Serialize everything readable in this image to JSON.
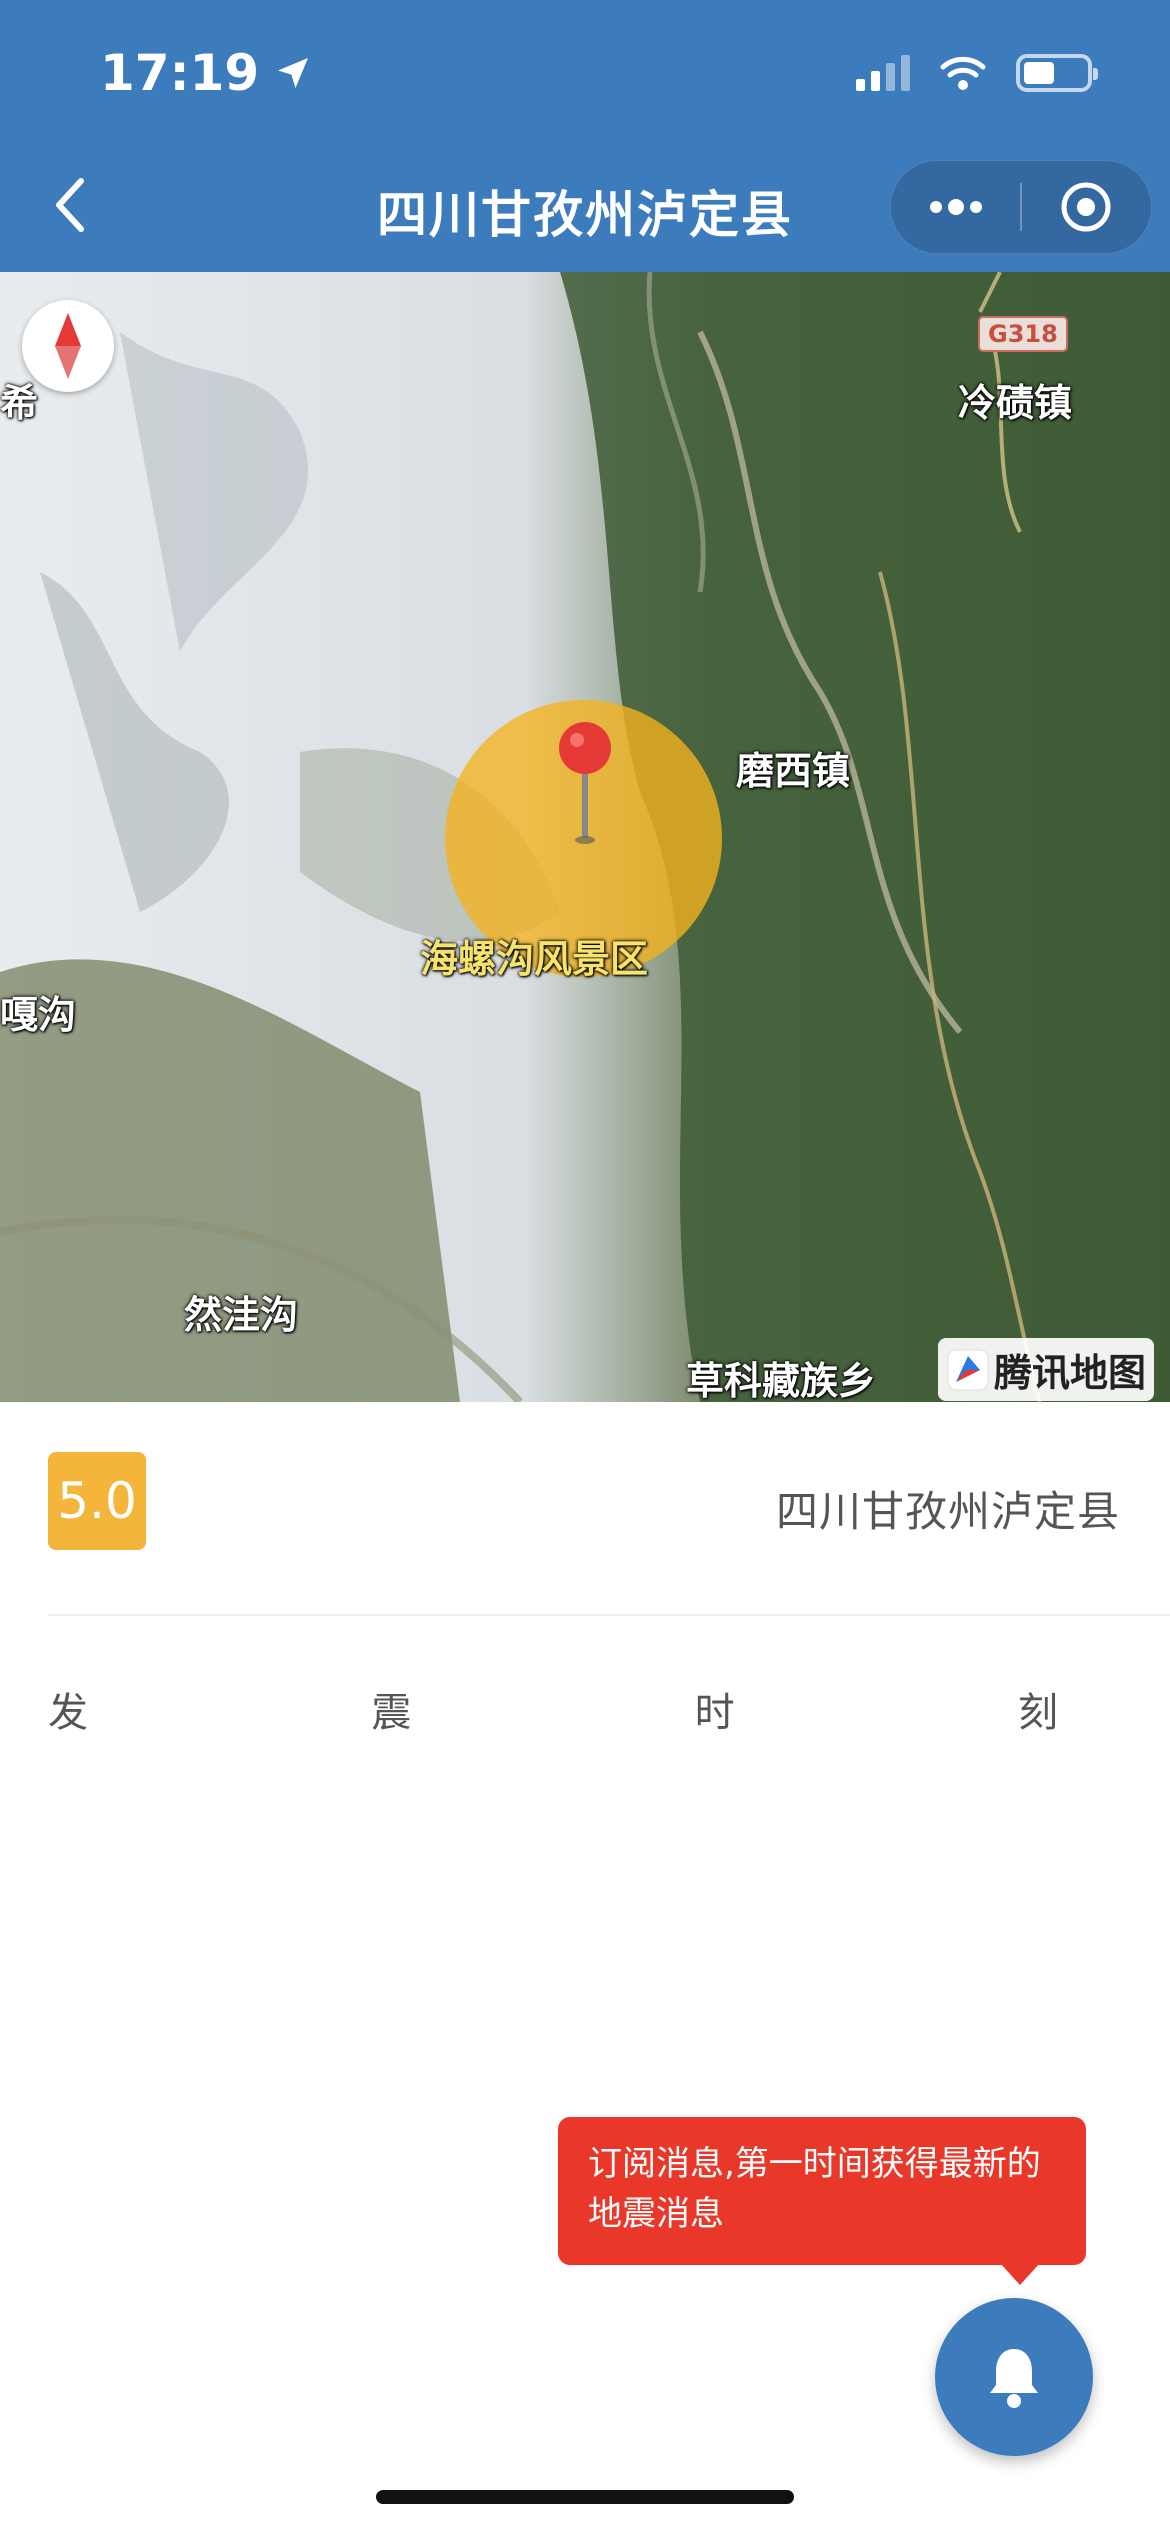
{
  "status_bar": {
    "time": "17:19"
  },
  "nav": {
    "title": "四川甘孜州泸定县"
  },
  "map": {
    "labels": {
      "xi": "希",
      "lengqi": "冷碛镇",
      "moxi": "磨西镇",
      "hailuogou": "海螺沟风景区",
      "gagou": "嘎沟",
      "ranwagou": "然洼沟",
      "caoke": "草科藏族乡"
    },
    "road_badge": "G318",
    "provider": "腾讯地图"
  },
  "quake": {
    "magnitude": "5.0",
    "location": "四川甘孜州泸定县",
    "time_label": [
      "发",
      "震",
      "时",
      "刻"
    ]
  },
  "subscribe": {
    "tooltip": "订阅消息,第一时间获得最新的地震消息"
  },
  "colors": {
    "header": "#3c7bbc",
    "magnitude": "#f3b53a",
    "tooltip": "#e9372a"
  }
}
